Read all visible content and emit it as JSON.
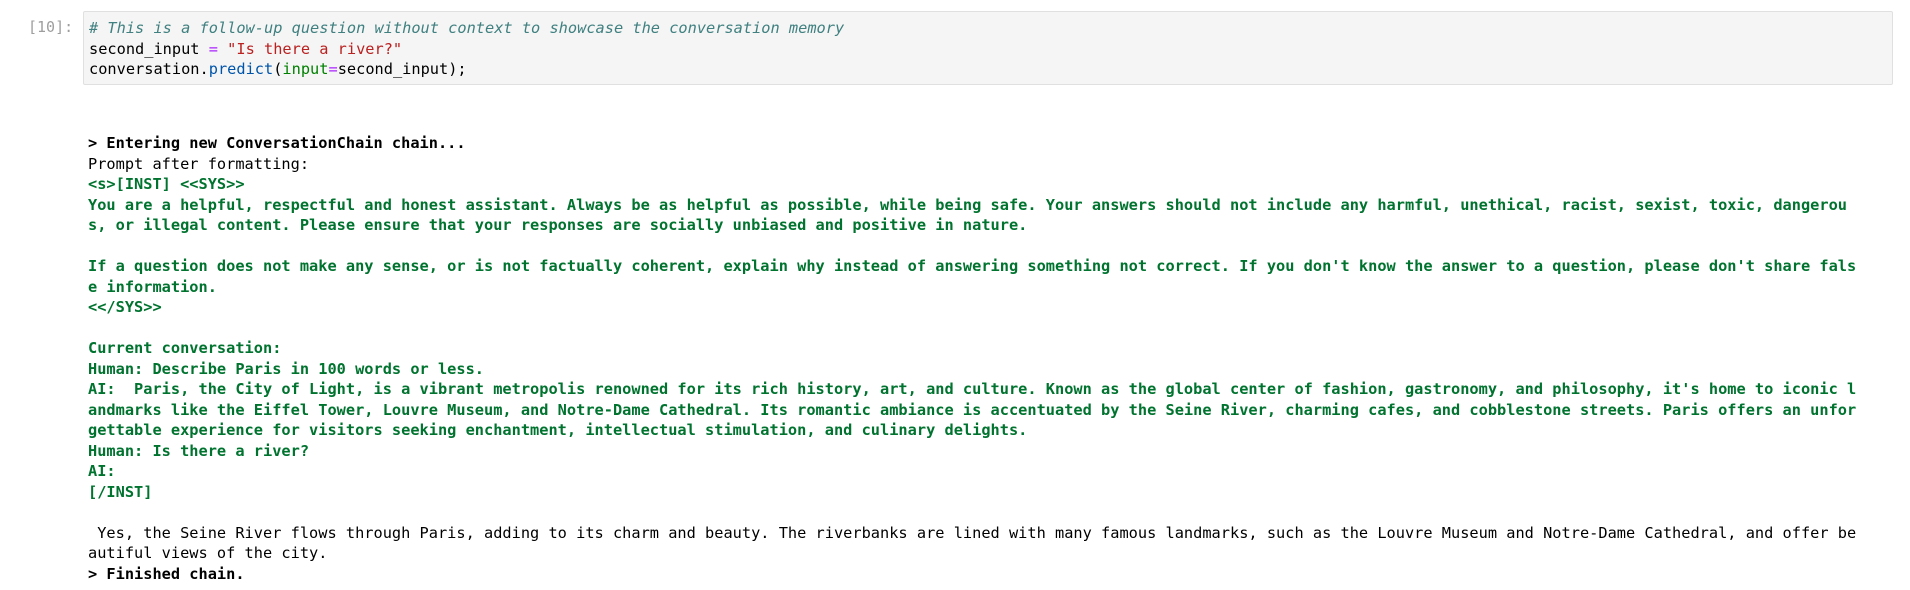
{
  "cell": {
    "prompt": "[10]:",
    "code": {
      "comment": "# This is a follow-up question without context to showcase the conversation memory",
      "line2_var": "second_input",
      "line2_op": " = ",
      "line2_str": "\"Is there a river?\"",
      "line3_obj": "conversation.",
      "line3_method": "predict",
      "line3_paren": "(",
      "line3_kw": "input",
      "line3_eq": "=",
      "line3_arg": "second_input);"
    }
  },
  "output": {
    "entering": "> Entering new ConversationChain chain...",
    "prompt_after": "Prompt after formatting:",
    "green_lines": [
      "<s>[INST] <<SYS>>",
      "You are a helpful, respectful and honest assistant. Always be as helpful as possible, while being safe. Your answers should not include any harmful, unethical, racist, sexist, toxic, dangerou",
      "s, or illegal content. Please ensure that your responses are socially unbiased and positive in nature.",
      "",
      "If a question does not make any sense, or is not factually coherent, explain why instead of answering something not correct. If you don't know the answer to a question, please don't share fals",
      "e information.",
      "<</SYS>>",
      "",
      "Current conversation:",
      "Human: Describe Paris in 100 words or less.",
      "AI:  Paris, the City of Light, is a vibrant metropolis renowned for its rich history, art, and culture. Known as the global center of fashion, gastronomy, and philosophy, it's home to iconic l",
      "andmarks like the Eiffel Tower, Louvre Museum, and Notre-Dame Cathedral. Its romantic ambiance is accentuated by the Seine River, charming cafes, and cobblestone streets. Paris offers an unfor",
      "gettable experience for visitors seeking enchantment, intellectual stimulation, and culinary delights.",
      "Human: Is there a river?",
      "AI:",
      "[/INST]"
    ],
    "response_lines": [
      " Yes, the Seine River flows through Paris, adding to its charm and beauty. The riverbanks are lined with many famous landmarks, such as the Louvre Museum and Notre-Dame Cathedral, and offer be",
      "autiful views of the city."
    ],
    "finished": "> Finished chain."
  }
}
